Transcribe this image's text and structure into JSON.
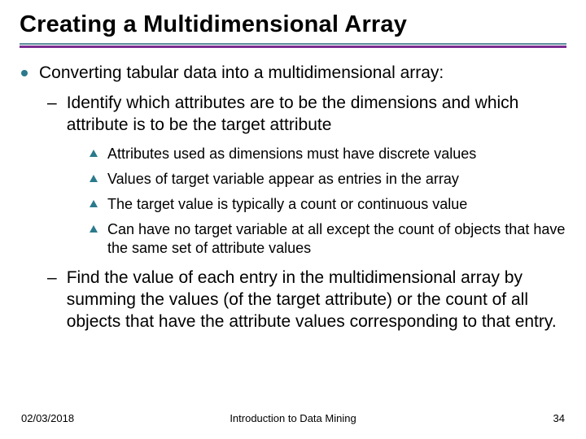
{
  "slide": {
    "title": "Creating a Multidimensional Array",
    "l1": "Converting tabular data into a multidimensional array:",
    "l2a": "Identify which attributes are to be the dimensions and which attribute is to be the target attribute",
    "l3a": "Attributes used as dimensions must have discrete values",
    "l3b": "Values of target variable appear as entries in the array",
    "l3c": "The target value is typically a count or continuous value",
    "l3d": "Can have no target variable at all except the count of objects that have the same set of attribute values",
    "l2b": "Find the value of each entry in the multidimensional array by summing the values (of the target attribute) or the count of all objects that have the attribute values corresponding to that entry."
  },
  "footer": {
    "date": "02/03/2018",
    "center": "Introduction to Data Mining",
    "page": "34"
  },
  "colors": {
    "accent_teal": "#2a7a8c",
    "accent_purple": "#7b2d91"
  }
}
